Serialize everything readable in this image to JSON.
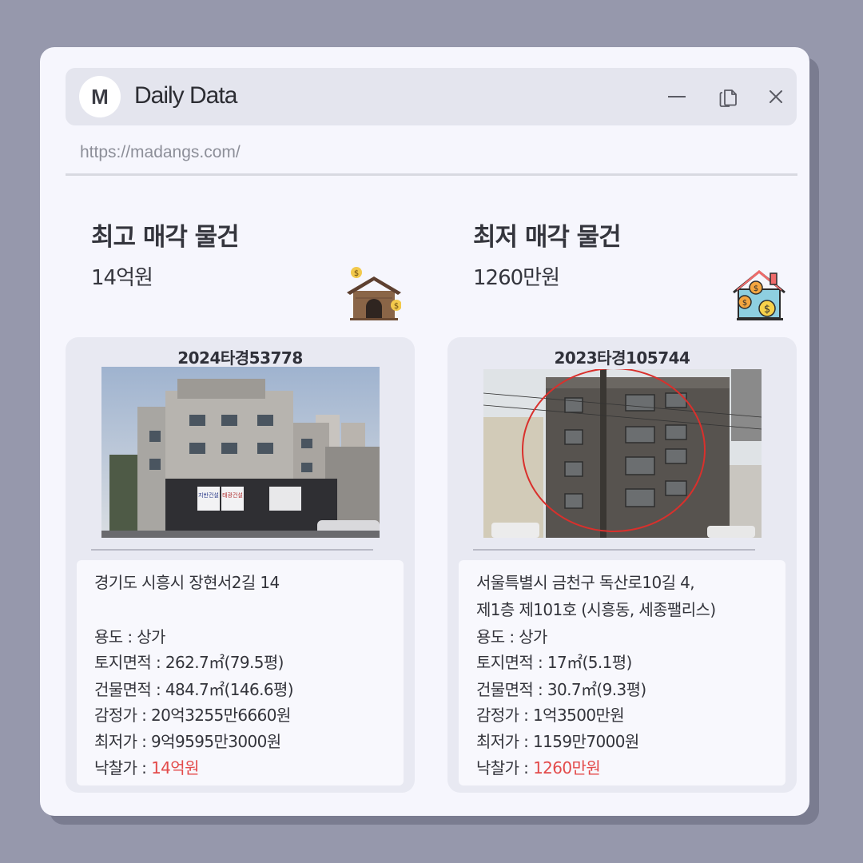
{
  "window": {
    "avatar_letter": "M",
    "title": "Daily Data",
    "url": "https://madangs.com/",
    "controls": [
      "minimize-icon",
      "copy-icon",
      "close-icon"
    ]
  },
  "highest": {
    "heading": "최고 매각 물건",
    "price": "14억원",
    "icon": "house-money-icon",
    "case_no": "2024타경53778",
    "address_line1": "경기도 시흥시 장현서2길 14",
    "address_line2": "",
    "usage": "용도 : 상가",
    "land_area": "토지면적 : 262.7㎡(79.5평)",
    "building_area": "건물면적 : 484.7㎡(146.6평)",
    "appraisal": "감정가 : 20억3255만6660원",
    "minimum": "최저가 : 9억9595만3000원",
    "winning_label": "낙찰가 : ",
    "winning_value": "14억원",
    "signage": [
      "지반건설",
      "태광건설"
    ]
  },
  "lowest": {
    "heading": "최저 매각 물건",
    "price": "1260만원",
    "icon": "house-coins-icon",
    "case_no": "2023타경105744",
    "address_line1": "서울특별시 금천구 독산로10길 4,",
    "address_line2": "제1층 제101호 (시흥동, 세종팰리스)",
    "usage": "용도 :  상가",
    "land_area": "토지면적 : 17㎡(5.1평)",
    "building_area": "건물면적 : 30.7㎡(9.3평)",
    "appraisal": "감정가 : 1억3500만원",
    "minimum": "최저가 : 1159만7000원",
    "winning_label": "낙찰가 : ",
    "winning_value": "1260만원"
  },
  "colors": {
    "background": "#9698ac",
    "panel": "#f6f6fd",
    "card": "#e8e9f2",
    "accent_red": "#e34a4a"
  }
}
